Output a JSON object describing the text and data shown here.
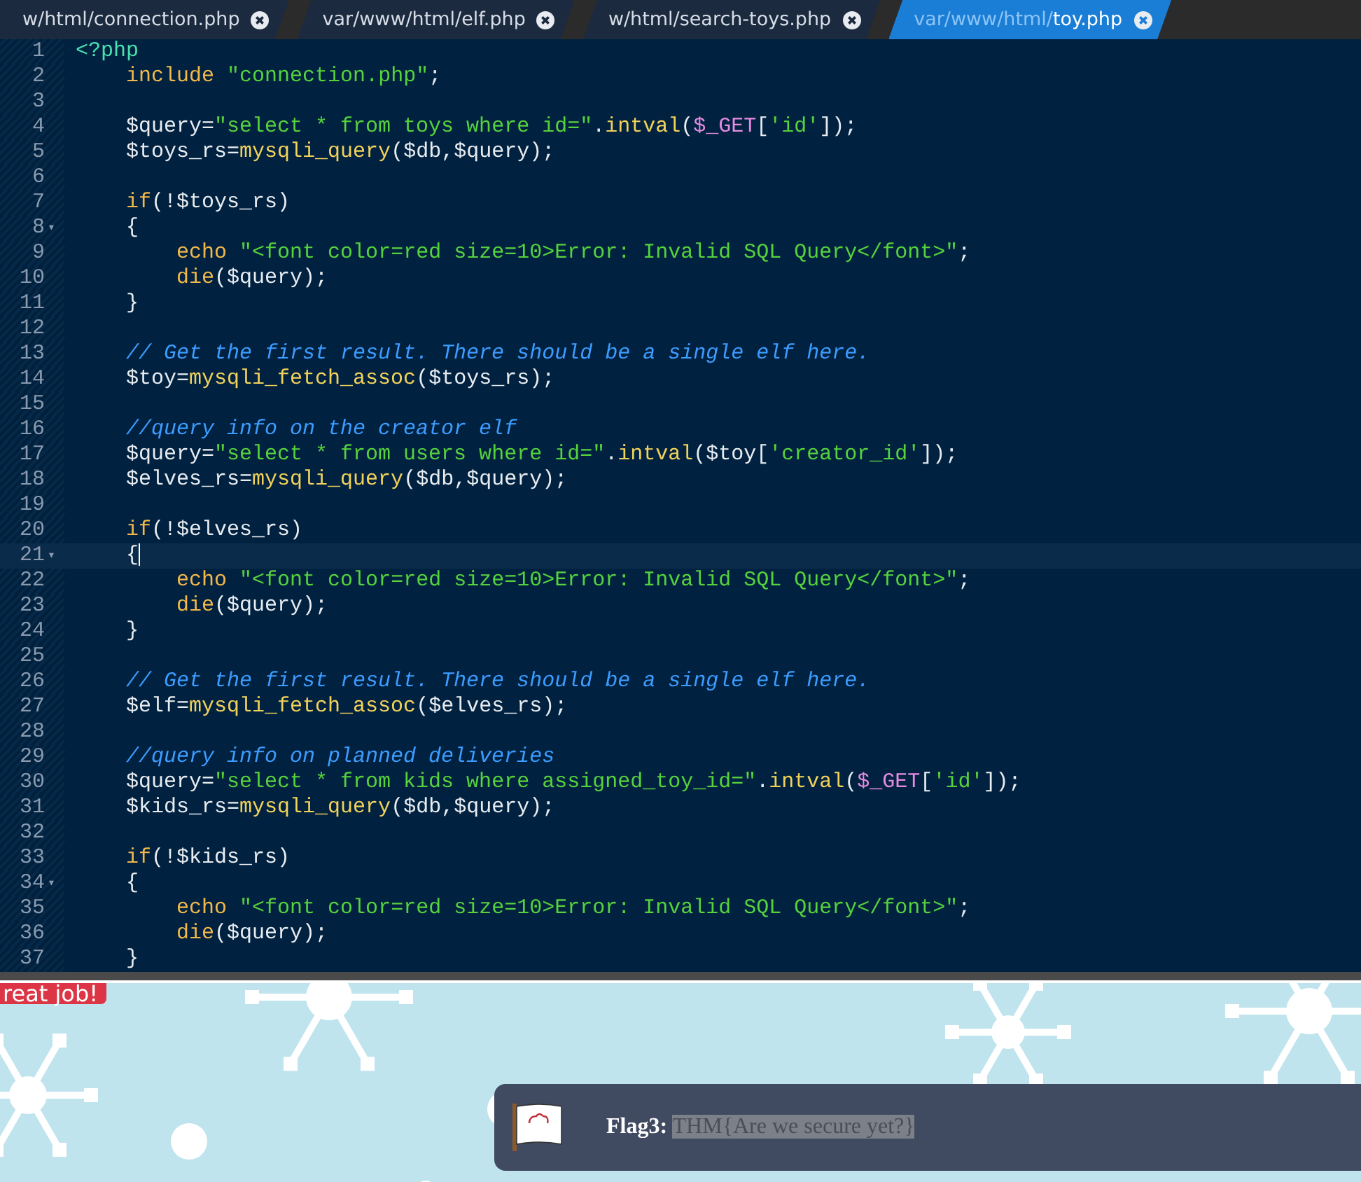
{
  "tabs": [
    {
      "dir": "w/html/",
      "file": "connection.php",
      "selected": false
    },
    {
      "dir": "var/www/html/",
      "file": "elf.php",
      "selected": false
    },
    {
      "dir": "w/html/",
      "file": "search-toys.php",
      "selected": false
    },
    {
      "dir": "var/www/html/",
      "file": "toy.php",
      "selected": true
    }
  ],
  "editor": {
    "lines": [
      {
        "number": "1",
        "current": false,
        "tokens": [
          {
            "kind": "tag",
            "text": "<?php"
          }
        ]
      },
      {
        "number": "2",
        "current": false,
        "tokens": [
          {
            "kind": "keyword",
            "text": "    include"
          },
          {
            "kind": "string",
            "text": " \"connection.php\""
          },
          {
            "kind": "plain",
            "text": ";"
          }
        ]
      },
      {
        "number": "3",
        "current": false
      },
      {
        "number": "4",
        "current": false,
        "tokens": [
          {
            "kind": "plain",
            "text": "    $query="
          },
          {
            "kind": "string",
            "text": "\"select * from toys where id=\""
          },
          {
            "kind": "plain",
            "text": "."
          },
          {
            "kind": "function",
            "text": "intval"
          },
          {
            "kind": "plain",
            "text": "("
          },
          {
            "kind": "global",
            "text": "$_GET"
          },
          {
            "kind": "plain",
            "text": "["
          },
          {
            "kind": "string",
            "text": "'id'"
          },
          {
            "kind": "plain",
            "text": "]);"
          }
        ]
      },
      {
        "number": "5",
        "current": false,
        "tokens": [
          {
            "kind": "plain",
            "text": "    $toys_rs="
          },
          {
            "kind": "function",
            "text": "mysqli_query"
          },
          {
            "kind": "plain",
            "text": "($db,$query);"
          }
        ]
      },
      {
        "number": "6",
        "current": false
      },
      {
        "number": "7",
        "current": false,
        "tokens": [
          {
            "kind": "keyword",
            "text": "    if"
          },
          {
            "kind": "plain",
            "text": "(!$toys_rs)"
          }
        ]
      },
      {
        "number": "8",
        "fold_marker": "▾",
        "current": false,
        "tokens": [
          {
            "kind": "plain",
            "text": "    {"
          }
        ]
      },
      {
        "number": "9",
        "current": false,
        "tokens": [
          {
            "kind": "keyword",
            "text": "        echo"
          },
          {
            "kind": "string",
            "text": " \"<font color=red size=10>Error: Invalid SQL Query</font>\""
          },
          {
            "kind": "plain",
            "text": ";"
          }
        ]
      },
      {
        "number": "10",
        "current": false,
        "tokens": [
          {
            "kind": "keyword",
            "text": "        die"
          },
          {
            "kind": "plain",
            "text": "($query);"
          }
        ]
      },
      {
        "number": "11",
        "current": false,
        "tokens": [
          {
            "kind": "plain",
            "text": "    }"
          }
        ]
      },
      {
        "number": "12",
        "current": false
      },
      {
        "number": "13",
        "current": false,
        "tokens": [
          {
            "kind": "comment",
            "text": "    // Get the first result. There should be a single elf here."
          }
        ]
      },
      {
        "number": "14",
        "current": false,
        "tokens": [
          {
            "kind": "plain",
            "text": "    $toy="
          },
          {
            "kind": "function",
            "text": "mysqli_fetch_assoc"
          },
          {
            "kind": "plain",
            "text": "($toys_rs);"
          }
        ]
      },
      {
        "number": "15",
        "current": false
      },
      {
        "number": "16",
        "current": false,
        "tokens": [
          {
            "kind": "comment",
            "text": "    //query info on the creator elf"
          }
        ]
      },
      {
        "number": "17",
        "current": false,
        "tokens": [
          {
            "kind": "plain",
            "text": "    $query="
          },
          {
            "kind": "string",
            "text": "\"select * from users where id=\""
          },
          {
            "kind": "plain",
            "text": "."
          },
          {
            "kind": "function",
            "text": "intval"
          },
          {
            "kind": "plain",
            "text": "($toy["
          },
          {
            "kind": "string",
            "text": "'creator_id'"
          },
          {
            "kind": "plain",
            "text": "]);"
          }
        ]
      },
      {
        "number": "18",
        "current": false,
        "tokens": [
          {
            "kind": "plain",
            "text": "    $elves_rs="
          },
          {
            "kind": "function",
            "text": "mysqli_query"
          },
          {
            "kind": "plain",
            "text": "($db,$query);"
          }
        ]
      },
      {
        "number": "19",
        "current": false
      },
      {
        "number": "20",
        "current": false,
        "tokens": [
          {
            "kind": "keyword",
            "text": "    if"
          },
          {
            "kind": "plain",
            "text": "(!$elves_rs)"
          }
        ]
      },
      {
        "number": "21",
        "fold_marker": "▾",
        "current": true,
        "tokens": [
          {
            "kind": "plain",
            "text": "    {"
          }
        ]
      },
      {
        "number": "22",
        "current": false,
        "tokens": [
          {
            "kind": "keyword",
            "text": "        echo"
          },
          {
            "kind": "string",
            "text": " \"<font color=red size=10>Error: Invalid SQL Query</font>\""
          },
          {
            "kind": "plain",
            "text": ";"
          }
        ]
      },
      {
        "number": "23",
        "current": false,
        "tokens": [
          {
            "kind": "keyword",
            "text": "        die"
          },
          {
            "kind": "plain",
            "text": "($query);"
          }
        ]
      },
      {
        "number": "24",
        "current": false,
        "tokens": [
          {
            "kind": "plain",
            "text": "    }"
          }
        ]
      },
      {
        "number": "25",
        "current": false
      },
      {
        "number": "26",
        "current": false,
        "tokens": [
          {
            "kind": "comment",
            "text": "    // Get the first result. There should be a single elf here."
          }
        ]
      },
      {
        "number": "27",
        "current": false,
        "tokens": [
          {
            "kind": "plain",
            "text": "    $elf="
          },
          {
            "kind": "function",
            "text": "mysqli_fetch_assoc"
          },
          {
            "kind": "plain",
            "text": "($elves_rs);"
          }
        ]
      },
      {
        "number": "28",
        "current": false
      },
      {
        "number": "29",
        "current": false,
        "tokens": [
          {
            "kind": "comment",
            "text": "    //query info on planned deliveries"
          }
        ]
      },
      {
        "number": "30",
        "current": false,
        "tokens": [
          {
            "kind": "plain",
            "text": "    $query="
          },
          {
            "kind": "string",
            "text": "\"select * from kids where assigned_toy_id=\""
          },
          {
            "kind": "plain",
            "text": "."
          },
          {
            "kind": "function",
            "text": "intval"
          },
          {
            "kind": "plain",
            "text": "("
          },
          {
            "kind": "global",
            "text": "$_GET"
          },
          {
            "kind": "plain",
            "text": "["
          },
          {
            "kind": "string",
            "text": "'id'"
          },
          {
            "kind": "plain",
            "text": "]);"
          }
        ]
      },
      {
        "number": "31",
        "current": false,
        "tokens": [
          {
            "kind": "plain",
            "text": "    $kids_rs="
          },
          {
            "kind": "function",
            "text": "mysqli_query"
          },
          {
            "kind": "plain",
            "text": "($db,$query);"
          }
        ]
      },
      {
        "number": "32",
        "current": false
      },
      {
        "number": "33",
        "current": false,
        "tokens": [
          {
            "kind": "keyword",
            "text": "    if"
          },
          {
            "kind": "plain",
            "text": "(!$kids_rs)"
          }
        ]
      },
      {
        "number": "34",
        "fold_marker": "▾",
        "current": false,
        "tokens": [
          {
            "kind": "plain",
            "text": "    {"
          }
        ]
      },
      {
        "number": "35",
        "current": false,
        "tokens": [
          {
            "kind": "keyword",
            "text": "        echo"
          },
          {
            "kind": "string",
            "text": " \"<font color=red size=10>Error: Invalid SQL Query</font>\""
          },
          {
            "kind": "plain",
            "text": ";"
          }
        ]
      },
      {
        "number": "36",
        "current": false,
        "tokens": [
          {
            "kind": "keyword",
            "text": "        die"
          },
          {
            "kind": "plain",
            "text": "($query);"
          }
        ]
      },
      {
        "number": "37",
        "current": false,
        "tokens": [
          {
            "kind": "plain",
            "text": "    }"
          }
        ]
      }
    ]
  },
  "page": {
    "badge": "reat job!",
    "flag": {
      "label": "Flag3:",
      "value": "THM{Are we secure yet?}",
      "selected": true
    }
  }
}
